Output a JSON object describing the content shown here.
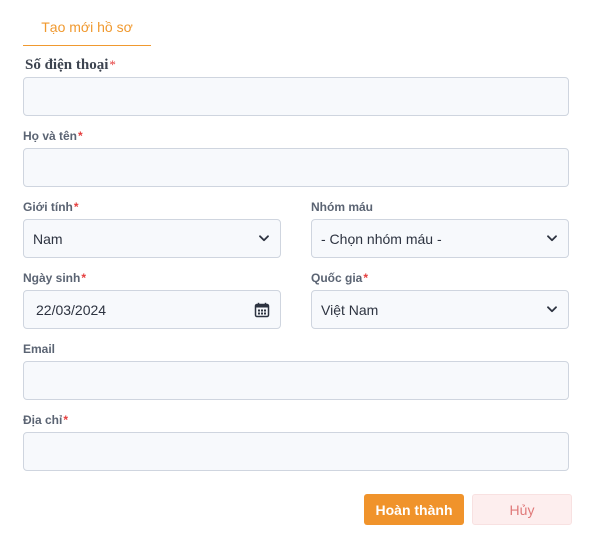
{
  "tabs": {
    "active_label": "Tạo mới hồ sơ"
  },
  "form": {
    "phone": {
      "label": "Số điện thoại",
      "value": ""
    },
    "fullname": {
      "label": "Họ và tên",
      "value": ""
    },
    "gender": {
      "label": "Giới tính",
      "value": "Nam"
    },
    "blood_group": {
      "label": "Nhóm máu",
      "value": "- Chọn nhóm máu -"
    },
    "birthdate": {
      "label": "Ngày sinh",
      "value": "22/03/2024"
    },
    "country": {
      "label": "Quốc gia",
      "value": "Việt Nam"
    },
    "email": {
      "label": "Email",
      "value": ""
    },
    "address": {
      "label": "Địa chỉ",
      "value": ""
    },
    "required_mark": "*"
  },
  "actions": {
    "submit_label": "Hoàn thành",
    "cancel_label": "Hủy"
  },
  "colors": {
    "accent": "#f0932b",
    "required": "#e53e3e",
    "cancel_bg": "#fdeeee"
  },
  "icons": {
    "select": "chevron-down-icon",
    "date": "calendar-icon"
  }
}
